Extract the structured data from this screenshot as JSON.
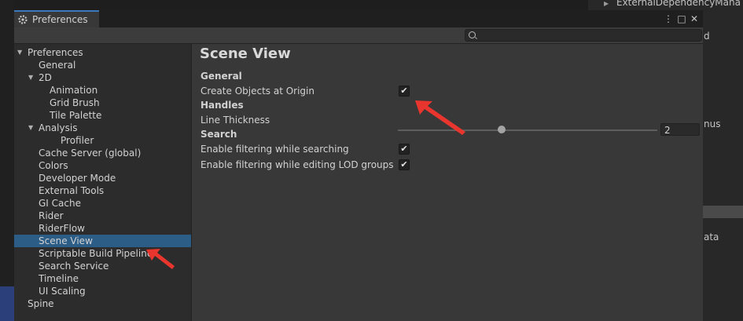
{
  "window": {
    "title": "Preferences",
    "menu_icon": "⋮",
    "maximize_icon": "□",
    "close_icon": "✕"
  },
  "search": {
    "value": ""
  },
  "sidebar": {
    "items": [
      {
        "label": "Preferences",
        "expanded": true
      },
      {
        "label": "General"
      },
      {
        "label": "2D",
        "expanded": true
      },
      {
        "label": "Animation"
      },
      {
        "label": "Grid Brush"
      },
      {
        "label": "Tile Palette"
      },
      {
        "label": "Analysis",
        "expanded": true
      },
      {
        "label": "Profiler"
      },
      {
        "label": "Cache Server (global)"
      },
      {
        "label": "Colors"
      },
      {
        "label": "Developer Mode"
      },
      {
        "label": "External Tools"
      },
      {
        "label": "GI Cache"
      },
      {
        "label": "Rider"
      },
      {
        "label": "RiderFlow"
      },
      {
        "label": "Scene View",
        "selected": true
      },
      {
        "label": "Scriptable Build Pipeline"
      },
      {
        "label": "Search Service"
      },
      {
        "label": "Timeline"
      },
      {
        "label": "UI Scaling"
      },
      {
        "label": "Spine"
      }
    ]
  },
  "content": {
    "title": "Scene View",
    "general": {
      "header": "General",
      "create_objects_label": "Create Objects at Origin",
      "create_objects_checked": true
    },
    "handles": {
      "header": "Handles",
      "line_thickness_label": "Line Thickness",
      "line_thickness_value": "2",
      "line_thickness_fraction": 0.4
    },
    "search": {
      "header": "Search",
      "filtering_label": "Enable filtering while searching",
      "filtering_checked": true,
      "lod_label": "Enable filtering while editing LOD groups",
      "lod_checked": true
    },
    "check_glyph": "✔"
  },
  "background": {
    "top_right_text": "ExternalDependencyMana",
    "right_text_1": "d",
    "right_text_2": "nus",
    "right_text_3": "ata"
  },
  "colors": {
    "accent": "#3a79bb",
    "selection": "#2c5d87",
    "annotation": "#e8352e"
  }
}
